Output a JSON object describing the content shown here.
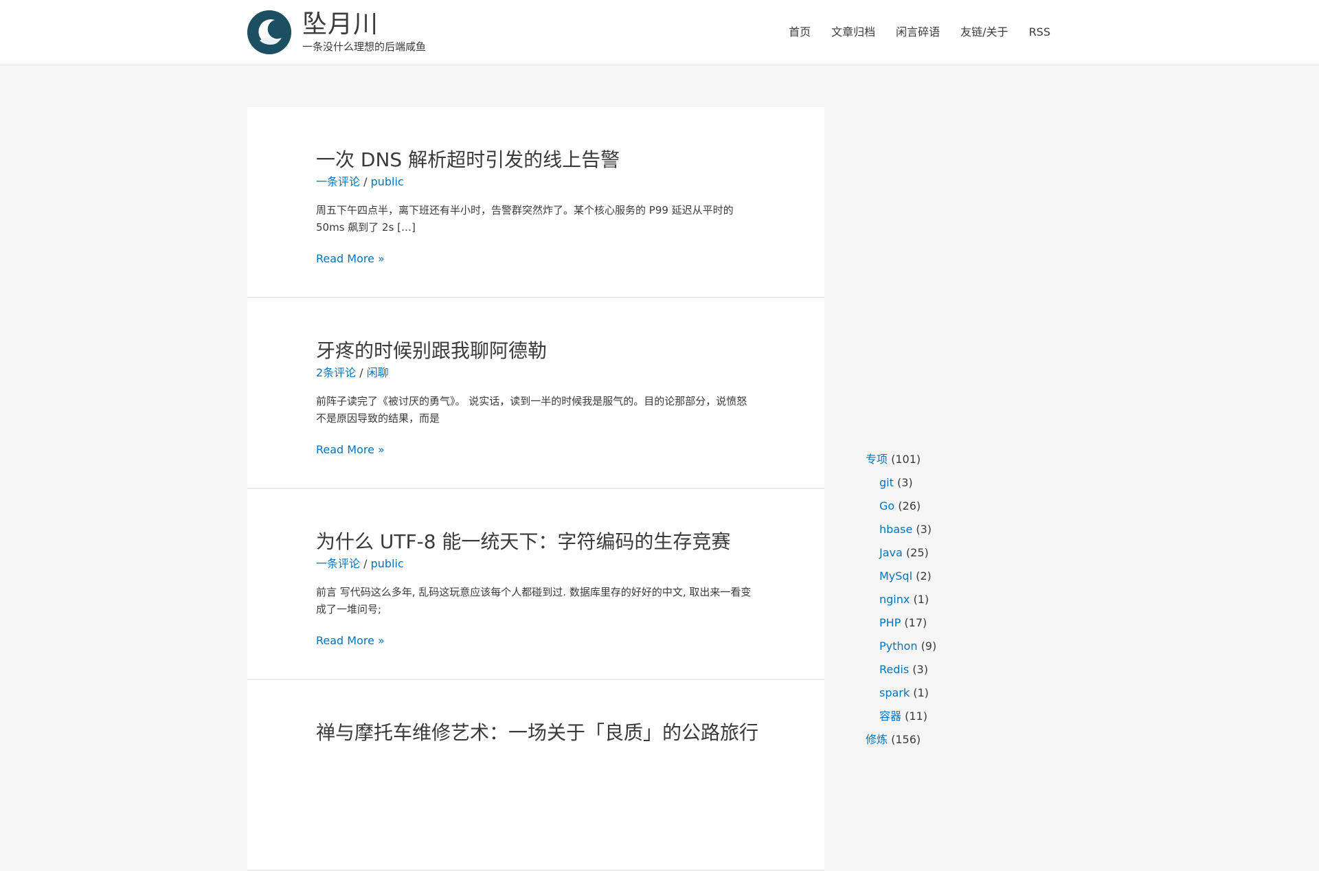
{
  "site": {
    "title": "坠月川",
    "tagline": "一条没什么理想的后端咸鱼"
  },
  "nav": [
    {
      "label": "首页"
    },
    {
      "label": "文章归档"
    },
    {
      "label": "闲言碎语"
    },
    {
      "label": "友链/关于"
    },
    {
      "label": "RSS"
    }
  ],
  "posts": [
    {
      "title": "一次 DNS 解析超时引发的线上告警",
      "comments": "一条评论",
      "category": "public",
      "excerpt": "周五下午四点半，离下班还有半小时，告警群突然炸了。某个核心服务的 P99 延迟从平时的 50ms 飙到了 2s […]",
      "read_more": "Read More »"
    },
    {
      "title": "牙疼的时候别跟我聊阿德勒",
      "comments": "2条评论",
      "category": "闲聊",
      "excerpt": "前阵子读完了《被讨厌的勇气》。 说实话，读到一半的时候我是服气的。目的论那部分，说愤怒不是原因导致的结果，而是",
      "read_more": "Read More »"
    },
    {
      "title": "为什么 UTF-8 能一统天下：字符编码的生存竞赛",
      "comments": "一条评论",
      "category": "public",
      "excerpt": "前言 写代码这么多年, 乱码这玩意应该每个人都碰到过. 数据库里存的好好的中文, 取出来一看变成了一堆问号;",
      "read_more": "Read More »"
    },
    {
      "title": "禅与摩托车维修艺术：一场关于「良质」的公路旅行",
      "comments": "",
      "category": "",
      "excerpt": "",
      "read_more": ""
    }
  ],
  "meta_separator": " / ",
  "categories": [
    {
      "name": "专项",
      "count": "(101)",
      "sub": false
    },
    {
      "name": "git",
      "count": "(3)",
      "sub": true
    },
    {
      "name": "Go",
      "count": "(26)",
      "sub": true
    },
    {
      "name": "hbase",
      "count": "(3)",
      "sub": true
    },
    {
      "name": "Java",
      "count": "(25)",
      "sub": true
    },
    {
      "name": "MySql",
      "count": "(2)",
      "sub": true
    },
    {
      "name": "nginx",
      "count": "(1)",
      "sub": true
    },
    {
      "name": "PHP",
      "count": "(17)",
      "sub": true
    },
    {
      "name": "Python",
      "count": "(9)",
      "sub": true
    },
    {
      "name": "Redis",
      "count": "(3)",
      "sub": true
    },
    {
      "name": "spark",
      "count": "(1)",
      "sub": true
    },
    {
      "name": "容器",
      "count": "(11)",
      "sub": true
    },
    {
      "name": "修炼",
      "count": "(156)",
      "sub": false
    }
  ],
  "colors": {
    "link": "#0274be",
    "text": "#3a3a3a",
    "background": "#f5f5f5",
    "logo_bg": "#1d4f62"
  }
}
